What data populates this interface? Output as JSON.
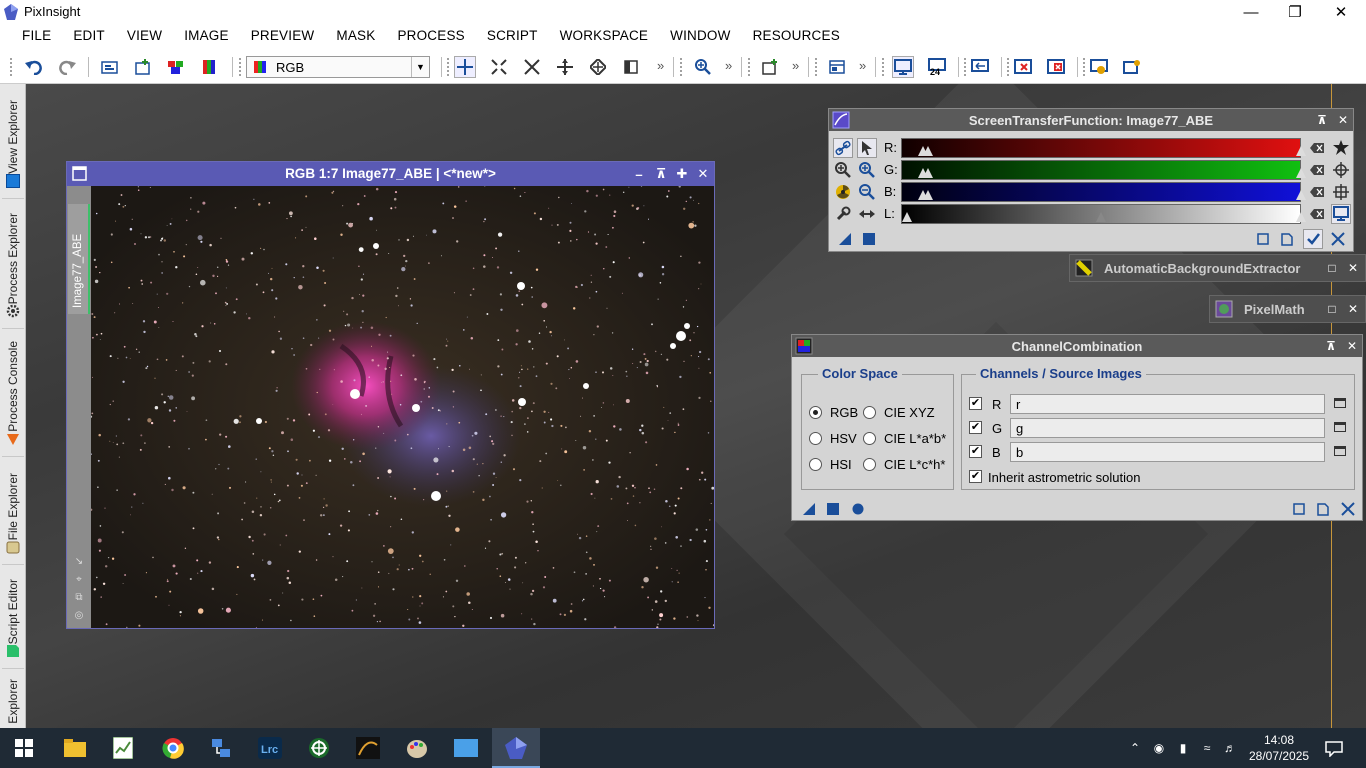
{
  "window": {
    "title": "PixInsight"
  },
  "menu": [
    "FILE",
    "EDIT",
    "VIEW",
    "IMAGE",
    "PREVIEW",
    "MASK",
    "PROCESS",
    "SCRIPT",
    "WORKSPACE",
    "WINDOW",
    "RESOURCES"
  ],
  "toolbar": {
    "colorspace": "RGB"
  },
  "sidebar": {
    "tabs": [
      "View Explorer",
      "Process Explorer",
      "Process Console",
      "File Explorer",
      "Script Editor",
      "Explorer"
    ]
  },
  "image_window": {
    "title": "RGB 1:7 Image77_ABE | <*new*>",
    "tab_label": "Image77_ABE"
  },
  "stf": {
    "title": "ScreenTransferFunction: Image77_ABE",
    "channels": [
      {
        "label": "R:",
        "color": "#e01010"
      },
      {
        "label": "G:",
        "color": "#10c010"
      },
      {
        "label": "B:",
        "color": "#1010d8"
      },
      {
        "label": "L:",
        "color": "#ffffff"
      }
    ]
  },
  "abe": {
    "title": "AutomaticBackgroundExtractor"
  },
  "pixelmath": {
    "title": "PixelMath"
  },
  "channel_combination": {
    "title": "ChannelCombination",
    "color_space": {
      "label": "Color Space",
      "options": [
        "RGB",
        "CIE XYZ",
        "HSV",
        "CIE L*a*b*",
        "HSI",
        "CIE L*c*h*"
      ],
      "selected": "RGB"
    },
    "channels": {
      "label": "Channels / Source Images",
      "rows": [
        {
          "label": "R",
          "value": "r"
        },
        {
          "label": "G",
          "value": "g"
        },
        {
          "label": "B",
          "value": "b"
        }
      ],
      "inherit_label": "Inherit astrometric solution"
    }
  },
  "taskbar": {
    "time": "14:08",
    "date": "28/07/2025"
  }
}
